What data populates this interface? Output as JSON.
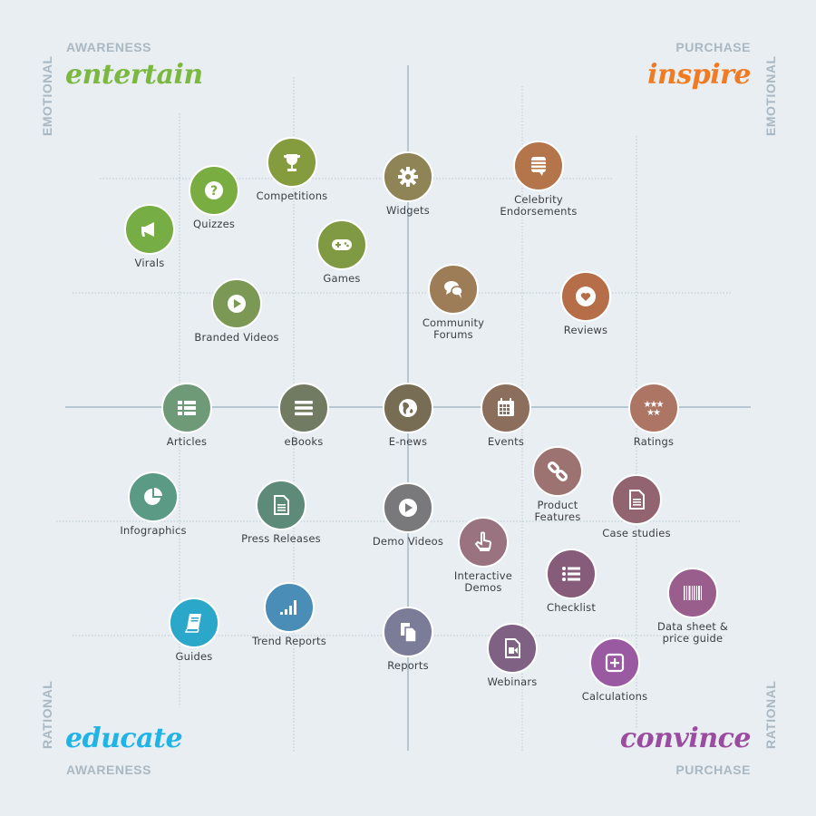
{
  "corners": {
    "top_left": {
      "title": "entertain",
      "subtitle": "AWARENESS",
      "side": "EMOTIONAL",
      "color": "#7ab83f"
    },
    "top_right": {
      "title": "inspire",
      "subtitle": "PURCHASE",
      "side": "EMOTIONAL",
      "color": "#f07b22"
    },
    "bottom_left": {
      "title": "educate",
      "subtitle": "AWARENESS",
      "side": "RATIONAL",
      "color": "#1fb3e8"
    },
    "bottom_right": {
      "title": "convince",
      "subtitle": "PURCHASE",
      "side": "RATIONAL",
      "color": "#9b4ba0"
    }
  },
  "colors": {
    "background": "#e9eef2",
    "axis": "#b7c7d2",
    "grid": "#b9c8d2",
    "muted_text": "#a9b8c2",
    "label_text": "#3b3f44"
  },
  "content_types": [
    {
      "label": "Virals",
      "icon": "megaphone-icon",
      "color": "#76ad44",
      "quadrant": "entertain"
    },
    {
      "label": "Quizzes",
      "icon": "question-icon",
      "color": "#79ad41",
      "quadrant": "entertain"
    },
    {
      "label": "Competitions",
      "icon": "trophy-icon",
      "color": "#849c3e",
      "quadrant": "entertain"
    },
    {
      "label": "Games",
      "icon": "gamepad-icon",
      "color": "#7f9a42",
      "quadrant": "entertain"
    },
    {
      "label": "Branded Videos",
      "icon": "play-icon",
      "color": "#7b9854",
      "quadrant": "entertain"
    },
    {
      "label": "Widgets",
      "icon": "gear-icon",
      "color": "#8f8456",
      "quadrant": "inspire"
    },
    {
      "label": "Celebrity\nEndorsements",
      "icon": "speech-list-icon",
      "color": "#b5754a",
      "quadrant": "inspire"
    },
    {
      "label": "Community\nForums",
      "icon": "chat-bubbles-icon",
      "color": "#9d7d58",
      "quadrant": "inspire"
    },
    {
      "label": "Reviews",
      "icon": "heart-icon",
      "color": "#b56e47",
      "quadrant": "inspire"
    },
    {
      "label": "Articles",
      "icon": "list-icon",
      "color": "#6f9a78",
      "quadrant": "educate"
    },
    {
      "label": "eBooks",
      "icon": "menu-icon",
      "color": "#707b62",
      "quadrant": "educate"
    },
    {
      "label": "E-news",
      "icon": "globe-icon",
      "color": "#776d54",
      "quadrant": "center"
    },
    {
      "label": "Events",
      "icon": "calendar-icon",
      "color": "#8b6e5c",
      "quadrant": "convince"
    },
    {
      "label": "Ratings",
      "icon": "stars-icon",
      "color": "#ad7564",
      "quadrant": "convince"
    },
    {
      "label": "Infographics",
      "icon": "pie-chart-icon",
      "color": "#5b9a84",
      "quadrant": "educate"
    },
    {
      "label": "Press Releases",
      "icon": "document-icon",
      "color": "#5e8a7a",
      "quadrant": "educate"
    },
    {
      "label": "Demo Videos",
      "icon": "play-icon",
      "color": "#79797c",
      "quadrant": "center"
    },
    {
      "label": "Product\nFeatures",
      "icon": "link-icon",
      "color": "#9c7370",
      "quadrant": "convince"
    },
    {
      "label": "Case studies",
      "icon": "document-icon",
      "color": "#926470",
      "quadrant": "convince"
    },
    {
      "label": "Interactive\nDemos",
      "icon": "pointer-hand-icon",
      "color": "#9a7380",
      "quadrant": "convince"
    },
    {
      "label": "Checklist",
      "icon": "checklist-icon",
      "color": "#875c7b",
      "quadrant": "convince"
    },
    {
      "label": "Data sheet &\nprice guide",
      "icon": "barcode-icon",
      "color": "#9a5e8c",
      "quadrant": "convince"
    },
    {
      "label": "Guides",
      "icon": "book-icon",
      "color": "#2ba7c9",
      "quadrant": "educate"
    },
    {
      "label": "Trend Reports",
      "icon": "signal-bars-icon",
      "color": "#4a8db6",
      "quadrant": "educate"
    },
    {
      "label": "Reports",
      "icon": "files-icon",
      "color": "#7a7c98",
      "quadrant": "center"
    },
    {
      "label": "Webinars",
      "icon": "video-file-icon",
      "color": "#7f6283",
      "quadrant": "convince"
    },
    {
      "label": "Calculations",
      "icon": "plus-square-icon",
      "color": "#9a5aa2",
      "quadrant": "convince"
    }
  ]
}
